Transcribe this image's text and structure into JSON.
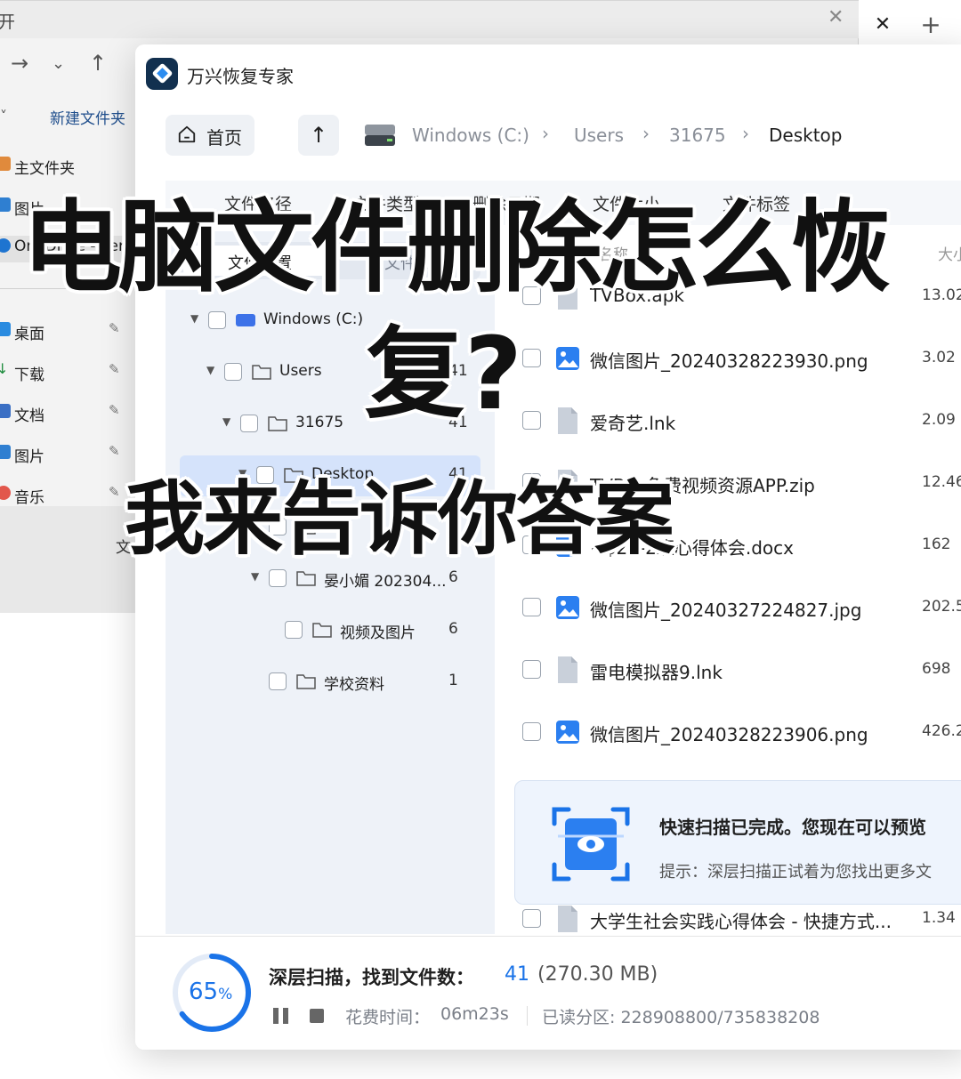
{
  "explorer": {
    "tab_title": "开",
    "new_folder": "新建文件夹",
    "sidebar": [
      {
        "label": "主文件夹",
        "icon": "home-icon"
      },
      {
        "label": "图片",
        "icon": "pictures-icon"
      },
      {
        "label": "OneDrive - Per",
        "icon": "onedrive-icon"
      },
      {
        "label": "桌面",
        "icon": "desktop-icon"
      },
      {
        "label": "下载",
        "icon": "download-icon"
      },
      {
        "label": "文档",
        "icon": "documents-icon"
      },
      {
        "label": "图片",
        "icon": "pictures-icon"
      },
      {
        "label": "音乐",
        "icon": "music-icon"
      }
    ],
    "status_text": "文"
  },
  "app": {
    "title": "万兴恢复专家",
    "home_label": "首页",
    "breadcrumb": [
      "Windows (C:)",
      "Users",
      "31675",
      "Desktop"
    ],
    "filters": [
      "文件路径",
      "文件类型",
      "删除日期",
      "文件大小",
      "文件标签"
    ],
    "segment": {
      "location": "文件位置",
      "type": "文件类型"
    },
    "tree": [
      {
        "name": "Windows (C:)",
        "count": ""
      },
      {
        "name": "Users",
        "count": "41"
      },
      {
        "name": "31675",
        "count": "41"
      },
      {
        "name": "Desktop",
        "count": "41"
      },
      {
        "name": "77",
        "count": "1"
      },
      {
        "name": "晏小媚 202304...",
        "count": "6"
      },
      {
        "name": "视频及图片",
        "count": "6"
      },
      {
        "name": "学校资料",
        "count": "1"
      }
    ],
    "list_header": {
      "name": "名称",
      "size": "大小"
    },
    "files": [
      {
        "name": "TVBox.apk",
        "size": "13.02",
        "type": "generic"
      },
      {
        "name": "微信图片_20240328223930.png",
        "size": "3.02",
        "type": "image"
      },
      {
        "name": "爱奇艺.lnk",
        "size": "2.09",
        "type": "generic"
      },
      {
        "name": "TVBox免费视频资源APP.zip",
        "size": "12.46",
        "type": "generic"
      },
      {
        "name": "~$23-2班心得体会.docx",
        "size": "162",
        "type": "word"
      },
      {
        "name": "微信图片_20240327224827.jpg",
        "size": "202.5",
        "type": "image"
      },
      {
        "name": "雷电模拟器9.lnk",
        "size": "698",
        "type": "generic"
      },
      {
        "name": "微信图片_20240328223906.png",
        "size": "426.2",
        "type": "image"
      },
      {
        "name": "大学生社会实践心得体会 - 快捷方式...",
        "size": "1.34",
        "type": "generic"
      }
    ],
    "toast": {
      "title": "快速扫描已完成。您现在可以预览",
      "hint": "提示：深层扫描正试着为您找出更多文"
    },
    "scan": {
      "progress": 65,
      "progress_number": "65",
      "progress_unit": "%",
      "label": "深层扫描，找到文件数：",
      "count": "41",
      "size": "(270.30 MB)",
      "time_label": "花费时间：",
      "time": "06m23s",
      "sectors": "已读分区: 228908800/735838208"
    }
  },
  "overlay": {
    "line1": "电脑文件删除怎么恢",
    "line2": "复?",
    "line3": "我来告诉你答案"
  },
  "colors": {
    "accent": "#1a73e8",
    "app_logo_bg": "#12304f",
    "selection": "#d5e3fb"
  }
}
